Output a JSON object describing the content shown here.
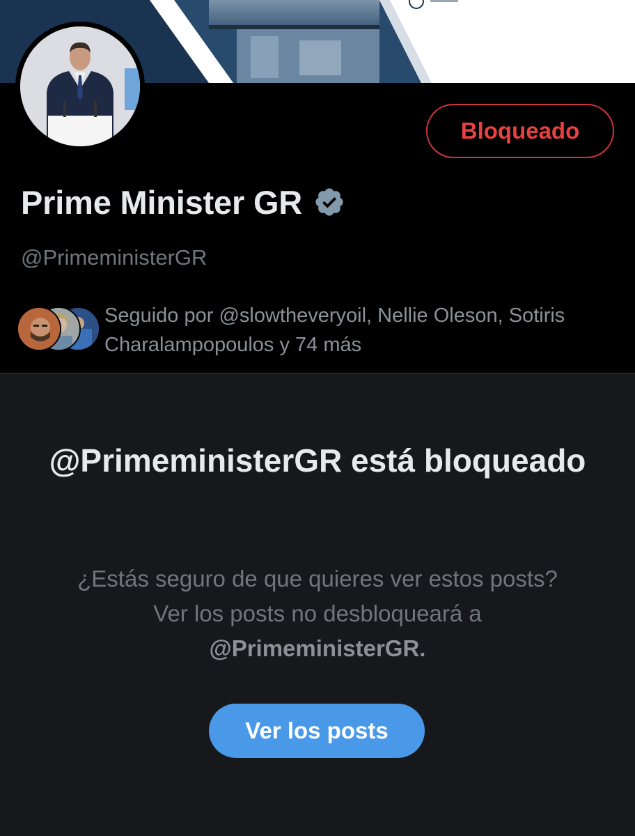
{
  "profile": {
    "display_name": "Prime Minister GR",
    "handle": "@PrimeministerGR",
    "verified": true,
    "verified_icon": "verified-badge-icon",
    "block_button_label": "Bloqueado",
    "followed_by": "Seguido por @slowtheveryoil, Nellie Oleson, Sotiris Charalampopoulos y 74 más"
  },
  "blocked_notice": {
    "title": "@PrimeministerGR está bloqueado",
    "description": "¿Estás seguro de que quieres ver estos posts? Ver los posts no desbloqueará a",
    "handle_emphasis": "@PrimeministerGR.",
    "button_label": "Ver los posts"
  },
  "colors": {
    "background_top": "#000000",
    "background_bottom": "#16181c",
    "blocked_red": "#e9413f",
    "accent_blue": "#4a99e9",
    "verified_gray": "#829aab"
  }
}
